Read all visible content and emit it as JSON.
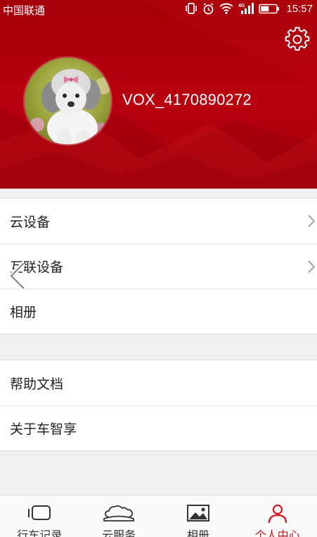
{
  "status_bar": {
    "carrier": "中国联通",
    "network": "4G",
    "time": "15:57"
  },
  "profile": {
    "username": "VOX_4170890272",
    "avatar": "poodle-photo"
  },
  "menu": {
    "group1": [
      {
        "label": "云设备",
        "has_arrow": true
      },
      {
        "label": "互联设备",
        "has_arrow": true
      },
      {
        "label": "相册",
        "has_arrow": false
      }
    ],
    "group2": [
      {
        "label": "帮助文档"
      },
      {
        "label": "关于车智享"
      }
    ]
  },
  "bottom_nav": [
    {
      "label": "行车记录",
      "icon": "dashcam-icon",
      "active": false
    },
    {
      "label": "云服务",
      "icon": "cloud-car-icon",
      "active": false
    },
    {
      "label": "相册",
      "icon": "album-icon",
      "active": false
    },
    {
      "label": "个人中心",
      "icon": "person-icon",
      "active": true
    }
  ],
  "colors": {
    "header_red": "#b8000f",
    "active_red": "#d4141f",
    "background": "#f0f0f0"
  }
}
